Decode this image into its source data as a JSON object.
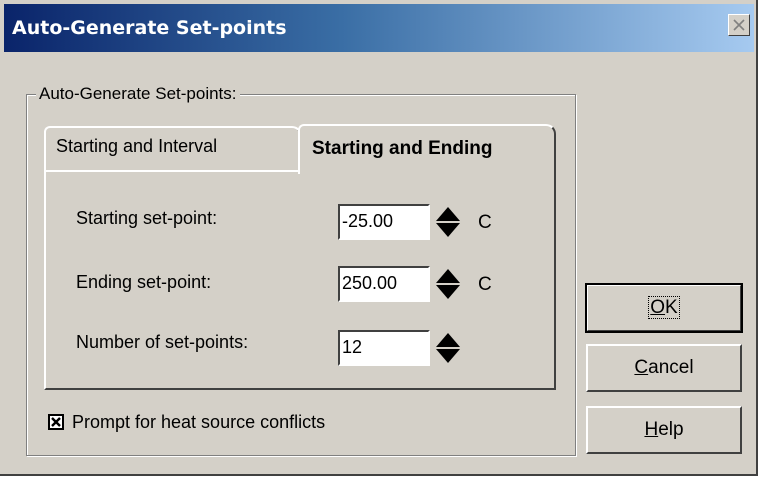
{
  "window": {
    "title": "Auto-Generate Set-points"
  },
  "group": {
    "legend": "Auto-Generate Set-points:"
  },
  "tabs": [
    {
      "label": "Starting and Interval",
      "active": false
    },
    {
      "label": "Starting and Ending",
      "active": true
    }
  ],
  "fields": {
    "starting": {
      "label": "Starting set-point:",
      "value": "-25.00",
      "unit": "C"
    },
    "ending": {
      "label": "Ending set-point:",
      "value": "250.00",
      "unit": "C"
    },
    "count": {
      "label": "Number of set-points:",
      "value": "12"
    }
  },
  "checkbox": {
    "label": "Prompt for heat source conflicts",
    "checked": true
  },
  "buttons": {
    "ok": {
      "mnemonic": "O",
      "rest": "K"
    },
    "cancel": {
      "mnemonic": "C",
      "rest": "ancel"
    },
    "help": {
      "mnemonic": "H",
      "rest": "elp"
    }
  },
  "icons": {
    "close": "close-icon",
    "spinner": "spinner-icon",
    "check": "check-icon"
  },
  "colors": {
    "face": "#d4d0c8",
    "title_start": "#0a246a",
    "title_end": "#a6caf0"
  }
}
